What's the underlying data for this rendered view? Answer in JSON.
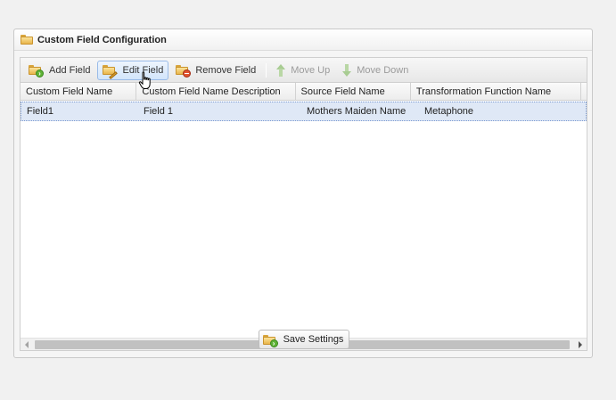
{
  "panel": {
    "title": "Custom Field Configuration"
  },
  "toolbar": {
    "add_label": "Add Field",
    "edit_label": "Edit Field",
    "remove_label": "Remove Field",
    "move_up_label": "Move Up",
    "move_down_label": "Move Down"
  },
  "grid": {
    "columns": [
      "Custom Field Name",
      "Custom Field Name Description",
      "Source Field Name",
      "Transformation Function Name"
    ],
    "rows": [
      {
        "name": "Field1",
        "description": "Field 1",
        "source": "Mothers Maiden Name",
        "function": "Metaphone"
      }
    ]
  },
  "footer": {
    "save_label": "Save Settings"
  },
  "icons": {
    "panel": "folder-icon",
    "add": "folder-add-icon",
    "edit": "folder-edit-icon",
    "remove": "folder-remove-icon",
    "up": "arrow-up-icon",
    "down": "arrow-down-icon",
    "save": "folder-save-icon",
    "cursor": "hand-pointer-icon"
  },
  "colors": {
    "selection": "#dfe8f6",
    "hover_border": "#99bbe8",
    "disabled_text": "#9b9b9b"
  }
}
